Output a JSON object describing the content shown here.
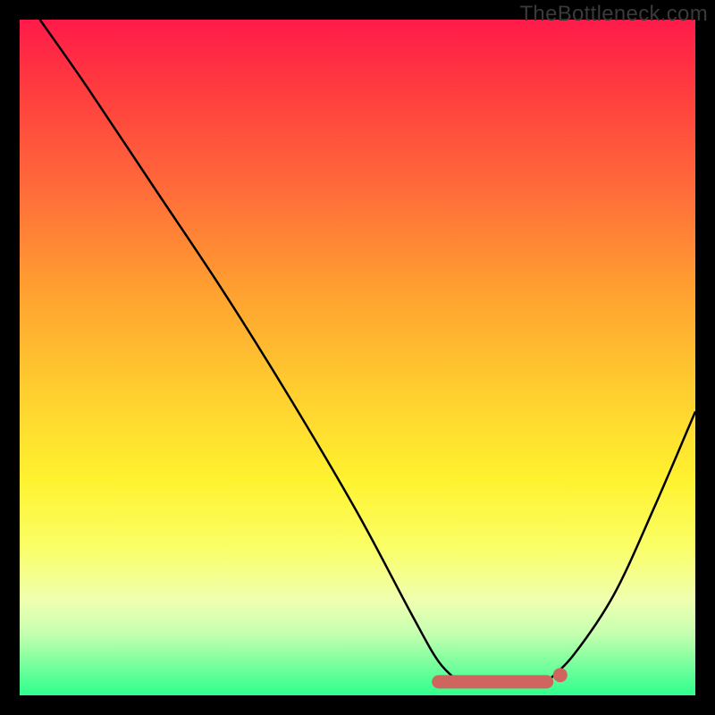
{
  "watermark": "TheBottleneck.com",
  "colors": {
    "gradient_top": "#ff1a4a",
    "gradient_bottom": "#2fff8e",
    "curve": "#000000",
    "marker": "#d0645e",
    "frame_border": "#000000"
  },
  "chart_data": {
    "type": "line",
    "title": "",
    "xlabel": "",
    "ylabel": "",
    "xlim": [
      0,
      100
    ],
    "ylim": [
      0,
      100
    ],
    "series": [
      {
        "name": "left-curve",
        "x": [
          3,
          10,
          20,
          30,
          40,
          50,
          58,
          62,
          65
        ],
        "y": [
          100,
          90,
          75,
          60,
          44,
          27,
          12,
          5,
          2
        ]
      },
      {
        "name": "right-curve",
        "x": [
          78,
          82,
          88,
          94,
          100
        ],
        "y": [
          2,
          6,
          15,
          28,
          42
        ]
      },
      {
        "name": "flat-marker",
        "x": [
          62,
          78
        ],
        "y": [
          2,
          2
        ]
      }
    ],
    "markers": [
      {
        "name": "dot",
        "x": 80,
        "y": 3
      }
    ]
  }
}
